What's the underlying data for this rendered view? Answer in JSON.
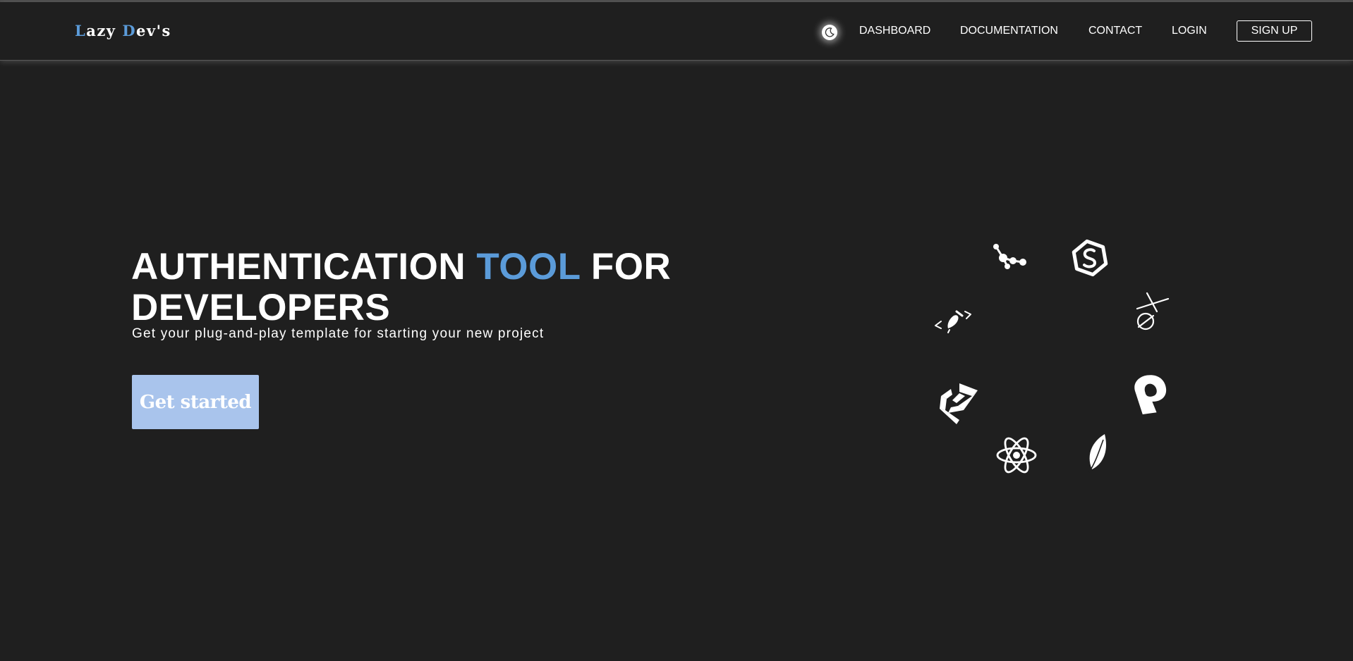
{
  "brand": {
    "logo_first_letter": "L",
    "logo_first_rest": "azy",
    "logo_second_letter": "D",
    "logo_second_rest": "ev's",
    "accent_color": "#5b9bd9"
  },
  "nav": {
    "theme_toggle_icon": "moon-icon",
    "items": [
      {
        "label": "DASHBOARD"
      },
      {
        "label": "DOCUMENTATION"
      },
      {
        "label": "CONTACT"
      },
      {
        "label": "LOGIN"
      }
    ],
    "signup_label": "SIGN UP"
  },
  "hero": {
    "title_part1": "AUTHENTICATION ",
    "title_accent": "TOOL",
    "title_part2": " FOR DEVELOPERS",
    "subtitle": "Get your plug-and-play template for starting your new project",
    "cta_label": "Get started",
    "cta_color": "#a9c4ec"
  },
  "tech_icons": [
    "molecule-nodes-icon",
    "hexagon-s-icon",
    "xp-symbol-icon",
    "pipedream-p-icon",
    "leaf-icon",
    "react-atom-icon",
    "zigzag-logo-icon",
    "brush-code-icon"
  ],
  "colors": {
    "background": "#1f1f1f",
    "text": "#ffffff"
  }
}
